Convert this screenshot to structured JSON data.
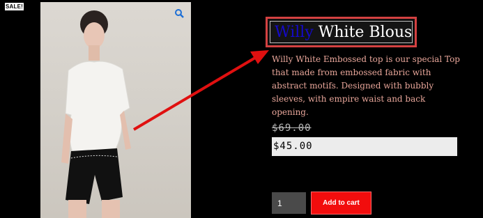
{
  "sale_badge": "SALE!",
  "product": {
    "title_highlight": "Willy",
    "title_rest": "White Blouse",
    "description": "Willy White Embossed top is our special Top that made from embossed fabric with abstract motifs. Designed with bubbly sleeves, with empire waist and back opening.",
    "old_price": "$69.00",
    "new_price": "$45.00"
  },
  "cart": {
    "quantity": "1",
    "add_label": "Add to cart"
  },
  "icons": {
    "zoom": "zoom-magnifier-icon"
  },
  "colors": {
    "background": "#000000",
    "title_highlight": "#1409c9",
    "annotation": "#e01010",
    "add_to_cart": "#f20d0d",
    "description": "#e8a69a"
  }
}
